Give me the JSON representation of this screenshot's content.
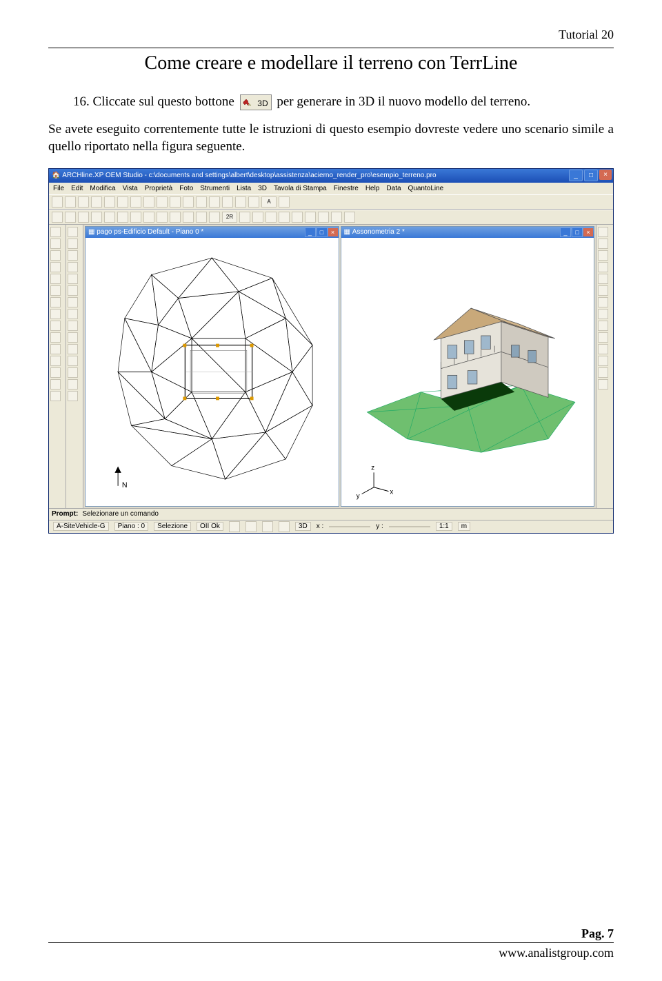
{
  "header": {
    "tutorial_label": "Tutorial 20"
  },
  "title": "Come creare e modellare il terreno con TerrLine",
  "step": {
    "prefix": "16. Cliccate sul questo bottone",
    "btn_label": "3D",
    "suffix": " per generare in 3D il nuovo modello del terreno."
  },
  "para": "Se avete eseguito correntemente tutte le istruzioni di questo esempio dovreste vedere uno scenario simile a quello riportato nella figura seguente.",
  "app": {
    "title": "ARCHline.XP OEM Studio - c:\\documents and settings\\albert\\desktop\\assistenza\\acierno_render_pro\\esempio_terreno.pro",
    "menus": [
      "File",
      "Edit",
      "Modifica",
      "Vista",
      "Proprietà",
      "Foto",
      "Strumenti",
      "Lista",
      "3D",
      "Tavola di Stampa",
      "Finestre",
      "Help",
      "Data",
      "QuantoLine"
    ],
    "doc_left_title": "pago ps-Edificio Default - Piano 0 *",
    "doc_right_title": "Assonometria 2 *",
    "axis_left": "N",
    "axis_right_z": "z",
    "axis_right_y": "y",
    "axis_right_x": "x",
    "prompt_label": "Prompt:",
    "prompt_text": "Selezionare un comando",
    "status": {
      "layer": "A-SiteVehicle-G",
      "piano": "Piano : 0",
      "selezione": "Selezione",
      "ok": "OII Ok",
      "d3": "3D",
      "xlabel": "x :",
      "ylabel": "y :",
      "scale": "1:1",
      "unit": "m"
    }
  },
  "footer": {
    "page": "Pag. 7",
    "url": "www.analistgroup.com"
  }
}
